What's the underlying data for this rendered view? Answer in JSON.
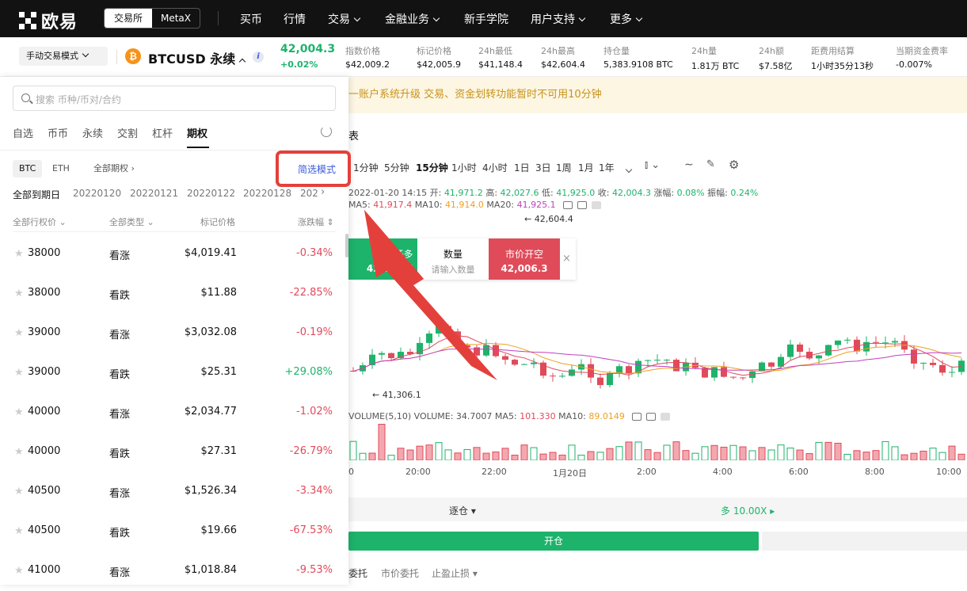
{
  "nav": {
    "logo": "欧易",
    "switch": [
      "交易所",
      "MetaX"
    ],
    "items": [
      {
        "label": "买币",
        "dd": false
      },
      {
        "label": "行情",
        "dd": false
      },
      {
        "label": "交易",
        "dd": true
      },
      {
        "label": "金融业务",
        "dd": true
      },
      {
        "label": "新手学院",
        "dd": false
      },
      {
        "label": "用户支持",
        "dd": true
      },
      {
        "label": "更多",
        "dd": true
      }
    ]
  },
  "ticker": {
    "mode": "手动交易模式",
    "coin_letter": "₿",
    "symbol": "BTCUSD 永续",
    "last": "42,004.3",
    "change": "+0.02%",
    "stats": [
      {
        "label": "指数价格",
        "value": "$42,009.2"
      },
      {
        "label": "标记价格",
        "value": "$42,005.9"
      },
      {
        "label": "24h最低",
        "value": "$41,148.4"
      },
      {
        "label": "24h最高",
        "value": "$42,604.4"
      },
      {
        "label": "持仓量",
        "value": "5,383.9108 BTC"
      },
      {
        "label": "24h量",
        "value": "1.81万 BTC"
      },
      {
        "label": "24h额",
        "value": "$7.58亿"
      },
      {
        "label": "距费用结算",
        "value": "1小时35分13秒"
      },
      {
        "label": "当期资金费率",
        "value": "-0.007%"
      }
    ]
  },
  "notice": "一账户系统升级 交易、资金划转功能暂时不可用10分钟",
  "chart": {
    "tab_fragment": "表",
    "timeframes": [
      "1分钟",
      "5分钟",
      "15分钟",
      "1小时",
      "4小时",
      "1日",
      "3日",
      "1周",
      "1月",
      "1年"
    ],
    "active_tf": "15分钟",
    "ohlc": {
      "date": "2022-01-20 14:15",
      "open_label": "开:",
      "open": "41,971.2",
      "high_label": "高:",
      "high": "42,027.6",
      "low_label": "低:",
      "low": "41,925.0",
      "close_label": "收:",
      "close": "42,004.3",
      "amp_label": "涨幅:",
      "amp": "0.08%",
      "vib_label": "振幅:",
      "vib": "0.24%"
    },
    "ma": {
      "ma5_label": "MA5:",
      "ma5": "41,917.4",
      "ma10_label": "MA10:",
      "ma10": "41,914.0",
      "ma20_label": "MA20:",
      "ma20": "41,925.1"
    },
    "high_marker": "← 42,604.4",
    "low_marker": "← 41,306.1",
    "volume": {
      "title": "VOLUME(5,10)",
      "vol_label": "VOLUME:",
      "vol": "34.7007",
      "ma5_label": "MA5:",
      "ma5": "101.330",
      "ma10_label": "MA10:",
      "ma10": "89.0149"
    },
    "time_axis": [
      "0",
      "20:00",
      "22:00",
      "1月20日",
      "2:00",
      "4:00",
      "6:00",
      "8:00",
      "10:00"
    ],
    "quick": {
      "buy_label": "市价开多",
      "buy_price": "42,006.4",
      "qty_label": "数量",
      "qty_placeholder": "请输入数量",
      "sell_label": "市价开空",
      "sell_price": "42,006.3",
      "close": "×"
    }
  },
  "order": {
    "margin": "逐仓 ▾",
    "leverage": "多 10.00X ▸",
    "open_btn": "开仓",
    "tabs": [
      "委托",
      "市价委托",
      "止盈止损 ▾"
    ]
  },
  "panel": {
    "search_placeholder": "搜索 币种/币对/合约",
    "categories": [
      "自选",
      "币币",
      "永续",
      "交割",
      "杠杆",
      "期权"
    ],
    "active_category": "期权",
    "coins": [
      "BTC",
      "ETH"
    ],
    "all_options": "全部期权",
    "simple_mode": "简选模式",
    "dates": [
      "全部到期日",
      "20220120",
      "20220121",
      "20220122",
      "20220128",
      "202"
    ],
    "headers": {
      "strike": "全部行权价",
      "type": "全部类型",
      "mark": "标记价格",
      "change": "涨跌幅"
    },
    "rows": [
      {
        "strike": "38000",
        "type": "看涨",
        "price": "$4,019.41",
        "change": "-0.34%",
        "dir": "down"
      },
      {
        "strike": "38000",
        "type": "看跌",
        "price": "$11.88",
        "change": "-22.85%",
        "dir": "down"
      },
      {
        "strike": "39000",
        "type": "看涨",
        "price": "$3,032.08",
        "change": "-0.19%",
        "dir": "down"
      },
      {
        "strike": "39000",
        "type": "看跌",
        "price": "$25.31",
        "change": "+29.08%",
        "dir": "up"
      },
      {
        "strike": "40000",
        "type": "看涨",
        "price": "$2,034.77",
        "change": "-1.02%",
        "dir": "down"
      },
      {
        "strike": "40000",
        "type": "看跌",
        "price": "$27.31",
        "change": "-26.79%",
        "dir": "down"
      },
      {
        "strike": "40500",
        "type": "看涨",
        "price": "$1,526.34",
        "change": "-3.34%",
        "dir": "down"
      },
      {
        "strike": "40500",
        "type": "看跌",
        "price": "$19.66",
        "change": "-67.53%",
        "dir": "down"
      },
      {
        "strike": "41000",
        "type": "看涨",
        "price": "$1,018.84",
        "change": "-9.53%",
        "dir": "down"
      }
    ]
  },
  "colors": {
    "up": "#1db36b",
    "down": "#e04b5a",
    "annotation": "#e4403b",
    "ma5": "#e04b5a",
    "ma10": "#f0a020",
    "ma20": "#c040c0"
  }
}
